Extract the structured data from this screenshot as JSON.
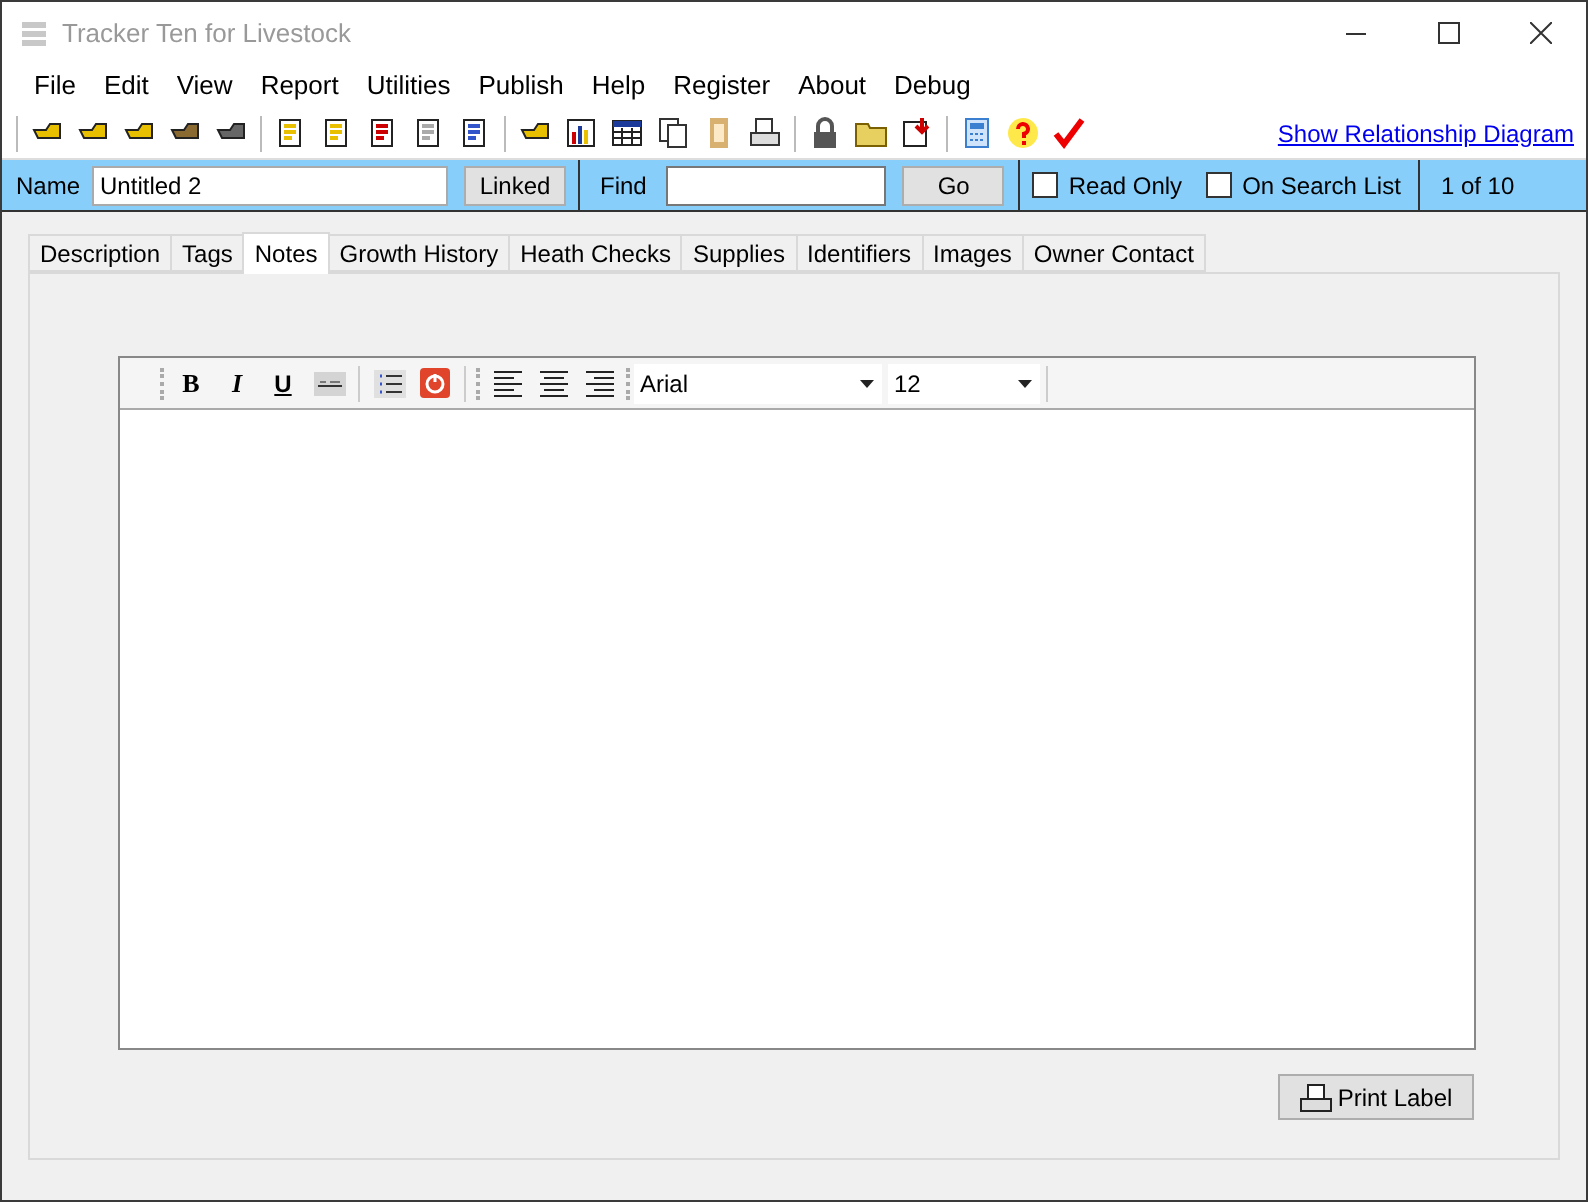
{
  "window": {
    "title": "Tracker Ten for Livestock"
  },
  "menu": [
    "File",
    "Edit",
    "View",
    "Report",
    "Utilities",
    "Publish",
    "Help",
    "Register",
    "About",
    "Debug"
  ],
  "toolbar": {
    "link": "Show Relationship Diagram"
  },
  "record_bar": {
    "name_label": "Name",
    "name_value": "Untitled 2",
    "linked_button": "Linked",
    "find_label": "Find",
    "go_button": "Go",
    "checkboxes": [
      {
        "label": "Read Only",
        "checked": false
      },
      {
        "label": "On Search List",
        "checked": false
      }
    ],
    "position": "1 of 10"
  },
  "tabs": [
    {
      "label": "Description",
      "selected": false
    },
    {
      "label": "Tags",
      "selected": false
    },
    {
      "label": "Notes",
      "selected": true
    },
    {
      "label": "Growth History",
      "selected": false
    },
    {
      "label": "Heath Checks",
      "selected": false
    },
    {
      "label": "Supplies",
      "selected": false
    },
    {
      "label": "Identifiers",
      "selected": false
    },
    {
      "label": "Images",
      "selected": false
    },
    {
      "label": "Owner Contact",
      "selected": false
    }
  ],
  "editor": {
    "format_buttons": [
      {
        "label": "B",
        "kind": "bold"
      },
      {
        "label": "I",
        "kind": "italic"
      },
      {
        "label": "U",
        "kind": "underline"
      }
    ],
    "font": "Arial",
    "size": "12"
  },
  "print_button": "Print Label"
}
